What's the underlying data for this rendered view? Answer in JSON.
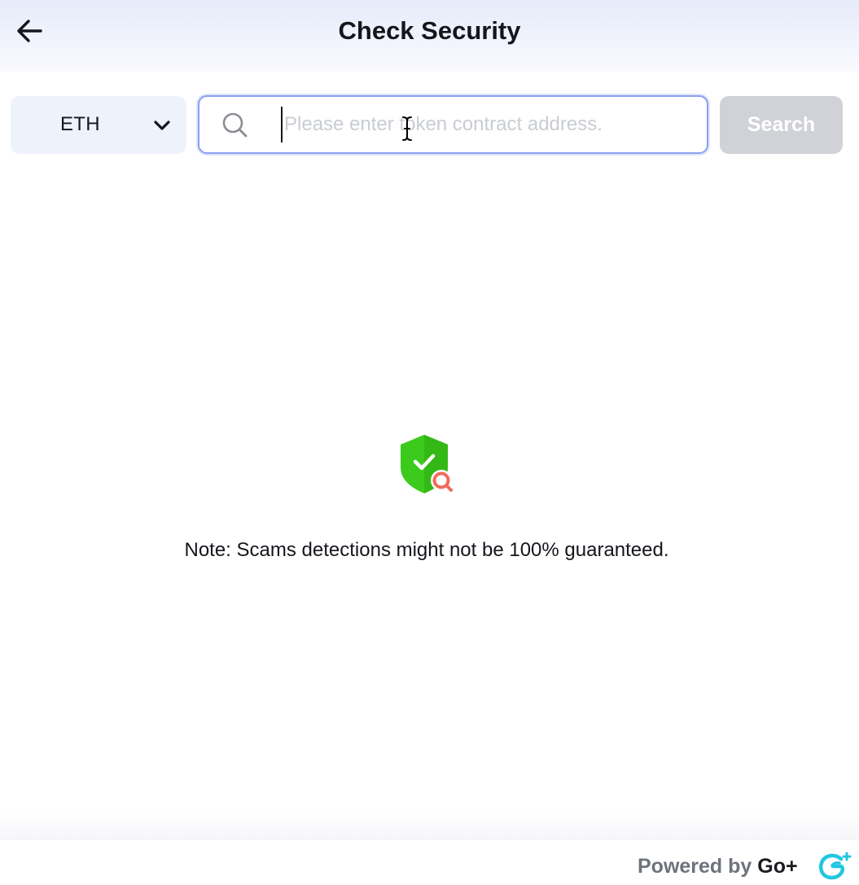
{
  "header": {
    "title": "Check Security",
    "back_icon": "arrow-left-icon"
  },
  "search_row": {
    "chain_selected": "ETH",
    "chain_icon": "chevron-down-icon",
    "input_value": "",
    "input_placeholder": "Please enter token contract address.",
    "search_icon": "search-icon",
    "search_button_label": "Search"
  },
  "empty_state": {
    "illustration_icon": "shield-check-search-icon",
    "note": "Note: Scams detections might not be 100% guaranteed."
  },
  "footer": {
    "powered_prefix": "Powered by ",
    "powered_brand": "Go+",
    "logo_icon": "goplus-logo-icon"
  },
  "colors": {
    "shield_green": "#3ccb1d",
    "magnifier_red": "#f06a5b",
    "logo_cyan": "#22c7e0",
    "input_focus_border": "#8aa0f0",
    "button_disabled": "#d0d2d8"
  }
}
